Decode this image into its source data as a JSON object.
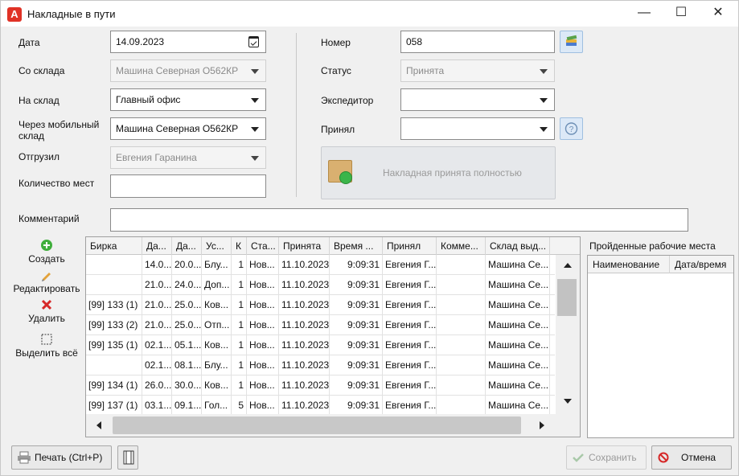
{
  "window": {
    "title": "Накладные в пути",
    "app_icon_letter": "A"
  },
  "form": {
    "date": {
      "label": "Дата",
      "value": "14.09.2023"
    },
    "from_warehouse": {
      "label": "Со склада",
      "value": "Машина Северная О562КР"
    },
    "to_warehouse": {
      "label": "На склад",
      "value": "Главный офис"
    },
    "via_mobile": {
      "label_line1": "Через мобильный",
      "label_line2": "склад",
      "value": "Машина Северная О562КР"
    },
    "shipped_by": {
      "label": "Отгрузил",
      "value": "Евгения Гаранина"
    },
    "places_count": {
      "label": "Количество мест",
      "value": ""
    },
    "number": {
      "label": "Номер",
      "value": "058"
    },
    "status": {
      "label": "Статус",
      "value": "Принята"
    },
    "forwarder": {
      "label": "Экспедитор",
      "value": ""
    },
    "received_by": {
      "label": "Принял",
      "value": ""
    },
    "accepted_fully": "Накладная принята полностью",
    "comment": {
      "label": "Комментарий",
      "value": ""
    }
  },
  "side_tools": {
    "create": "Создать",
    "edit": "Редактировать",
    "delete": "Удалить",
    "select_all": "Выделить всё"
  },
  "table": {
    "columns": [
      "Бирка",
      "Да...",
      "Да...",
      "Ус...",
      "К",
      "Ста...",
      "Принята",
      "Время ...",
      "Принял",
      "Комме...",
      "Склад выд..."
    ],
    "rows": [
      [
        "",
        "14.0...",
        "20.0...",
        "Блу...",
        "1",
        "Нов...",
        "11.10.2023",
        "9:09:31",
        "Евгения Г...",
        "",
        "Машина Се..."
      ],
      [
        "",
        "21.0...",
        "24.0...",
        "Доп...",
        "1",
        "Нов...",
        "11.10.2023",
        "9:09:31",
        "Евгения Г...",
        "",
        "Машина Се..."
      ],
      [
        "[99] 133 (1)",
        "21.0...",
        "25.0...",
        "Ков...",
        "1",
        "Нов...",
        "11.10.2023",
        "9:09:31",
        "Евгения Г...",
        "",
        "Машина Се..."
      ],
      [
        "[99] 133 (2)",
        "21.0...",
        "25.0...",
        "Отп...",
        "1",
        "Нов...",
        "11.10.2023",
        "9:09:31",
        "Евгения Г...",
        "",
        "Машина Се..."
      ],
      [
        "[99] 135 (1)",
        "02.1...",
        "05.1...",
        "Ков...",
        "1",
        "Нов...",
        "11.10.2023",
        "9:09:31",
        "Евгения Г...",
        "",
        "Машина Се..."
      ],
      [
        "",
        "02.1...",
        "08.1...",
        "Блу...",
        "1",
        "Нов...",
        "11.10.2023",
        "9:09:31",
        "Евгения Г...",
        "",
        "Машина Се..."
      ],
      [
        "[99] 134 (1)",
        "26.0...",
        "30.0...",
        "Ков...",
        "1",
        "Нов...",
        "11.10.2023",
        "9:09:31",
        "Евгения Г...",
        "",
        "Машина Се..."
      ],
      [
        "[99] 137 (1)",
        "03.1...",
        "09.1...",
        "Гол...",
        "5",
        "Нов...",
        "11.10.2023",
        "9:09:31",
        "Евгения Г...",
        "",
        "Машина Се..."
      ]
    ]
  },
  "workplaces": {
    "title": "Пройденные рабочие места",
    "columns": [
      "Наименование",
      "Дата/время"
    ]
  },
  "footer": {
    "print": "Печать (Ctrl+P)",
    "save": "Сохранить",
    "cancel": "Отмена"
  }
}
